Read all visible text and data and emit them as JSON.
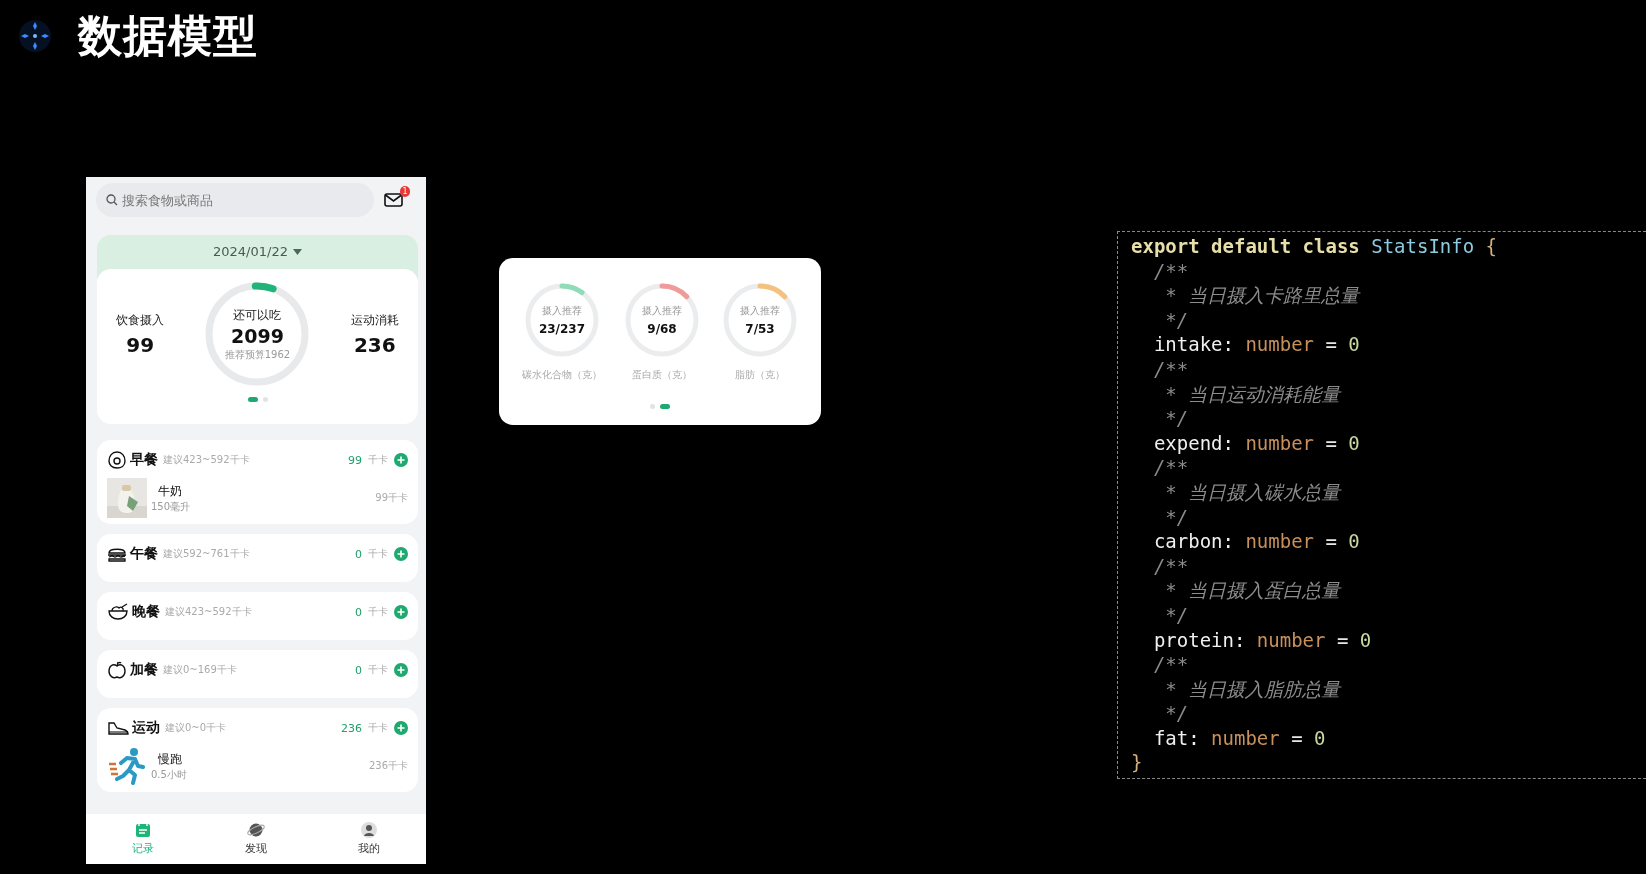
{
  "slide": {
    "title": "数据模型"
  },
  "phone": {
    "search": {
      "placeholder": "搜索食物或商品"
    },
    "mail_badge": "1",
    "summary": {
      "date": "2024/01/22",
      "intake": {
        "label": "饮食摄入",
        "value": "99"
      },
      "remaining": {
        "label": "还可以吃",
        "value": "2099",
        "note": "推荐预算1962",
        "level": 0.06
      },
      "expend": {
        "label": "运动消耗",
        "value": "236"
      },
      "pager": [
        {
          "selected": true
        },
        {
          "selected": false
        }
      ]
    },
    "meals": [
      {
        "kind": "egg",
        "name": "早餐",
        "hint": "建议423~592千卡",
        "value": "99",
        "unit": "千卡",
        "items": [
          {
            "kind": "milk",
            "name": "牛奶",
            "amount": "150毫升",
            "kcal": "99千卡"
          }
        ]
      },
      {
        "kind": "burger",
        "name": "午餐",
        "hint": "建议592~761千卡",
        "value": "0",
        "unit": "千卡"
      },
      {
        "kind": "bowl",
        "name": "晚餐",
        "hint": "建议423~592千卡",
        "value": "0",
        "unit": "千卡"
      },
      {
        "kind": "apple",
        "name": "加餐",
        "hint": "建议0~169千卡",
        "value": "0",
        "unit": "千卡"
      },
      {
        "kind": "shoe",
        "name": "运动",
        "hint": "建议0~0千卡",
        "value": "236",
        "unit": "千卡",
        "items": [
          {
            "kind": "runner",
            "name": "慢跑",
            "amount": "0.5小时",
            "kcal": "236千卡"
          }
        ]
      }
    ],
    "tabs": [
      {
        "kind": "record",
        "label": "记录",
        "selected": true
      },
      {
        "kind": "planet",
        "label": "发现",
        "selected": false
      },
      {
        "kind": "person",
        "label": "我的",
        "selected": false
      }
    ]
  },
  "macros_card": {
    "rings": [
      {
        "caption": "摄入推荐",
        "value": "23/237",
        "label": "碳水化合物（克）",
        "level": 0.1,
        "color": "#8fdcb8"
      },
      {
        "caption": "摄入推荐",
        "value": "9/68",
        "label": "蛋白质（克）",
        "level": 0.13,
        "color": "#f09a9a"
      },
      {
        "caption": "摄入推荐",
        "value": "7/53",
        "label": "脂肪（克）",
        "level": 0.13,
        "color": "#f5c27d"
      }
    ],
    "pager": [
      {
        "selected": false
      },
      {
        "selected": true
      }
    ]
  },
  "code": {
    "lines": [
      [
        {
          "kind": "keyword",
          "text": "export default class "
        },
        {
          "kind": "class",
          "text": "StatsInfo "
        },
        {
          "kind": "brace",
          "text": "{"
        }
      ],
      [
        {
          "kind": "comment",
          "text": "  /**"
        }
      ],
      [
        {
          "kind": "comment",
          "text": "   * 当日摄入卡路里总量"
        }
      ],
      [
        {
          "kind": "comment",
          "text": "   */"
        }
      ],
      [
        {
          "kind": "property",
          "text": "  intake: "
        },
        {
          "kind": "type",
          "text": "number"
        },
        {
          "kind": "operator",
          "text": " = "
        },
        {
          "kind": "number",
          "text": "0"
        }
      ],
      [
        {
          "kind": "comment",
          "text": "  /**"
        }
      ],
      [
        {
          "kind": "comment",
          "text": "   * 当日运动消耗能量"
        }
      ],
      [
        {
          "kind": "comment",
          "text": "   */"
        }
      ],
      [
        {
          "kind": "property",
          "text": "  expend: "
        },
        {
          "kind": "type",
          "text": "number"
        },
        {
          "kind": "operator",
          "text": " = "
        },
        {
          "kind": "number",
          "text": "0"
        }
      ],
      [
        {
          "kind": "comment",
          "text": "  /**"
        }
      ],
      [
        {
          "kind": "comment",
          "text": "   * 当日摄入碳水总量"
        }
      ],
      [
        {
          "kind": "comment",
          "text": "   */"
        }
      ],
      [
        {
          "kind": "property",
          "text": "  carbon: "
        },
        {
          "kind": "type",
          "text": "number"
        },
        {
          "kind": "operator",
          "text": " = "
        },
        {
          "kind": "number",
          "text": "0"
        }
      ],
      [
        {
          "kind": "comment",
          "text": "  /**"
        }
      ],
      [
        {
          "kind": "comment",
          "text": "   * 当日摄入蛋白总量"
        }
      ],
      [
        {
          "kind": "comment",
          "text": "   */"
        }
      ],
      [
        {
          "kind": "property",
          "text": "  protein: "
        },
        {
          "kind": "type",
          "text": "number"
        },
        {
          "kind": "operator",
          "text": " = "
        },
        {
          "kind": "number",
          "text": "0"
        }
      ],
      [
        {
          "kind": "comment",
          "text": "  /**"
        }
      ],
      [
        {
          "kind": "comment",
          "text": "   * 当日摄入脂肪总量"
        }
      ],
      [
        {
          "kind": "comment",
          "text": "   */"
        }
      ],
      [
        {
          "kind": "property",
          "text": "  fat: "
        },
        {
          "kind": "type",
          "text": "number"
        },
        {
          "kind": "operator",
          "text": " = "
        },
        {
          "kind": "number",
          "text": "0"
        }
      ],
      [
        {
          "kind": "brace",
          "text": "}"
        }
      ]
    ]
  }
}
